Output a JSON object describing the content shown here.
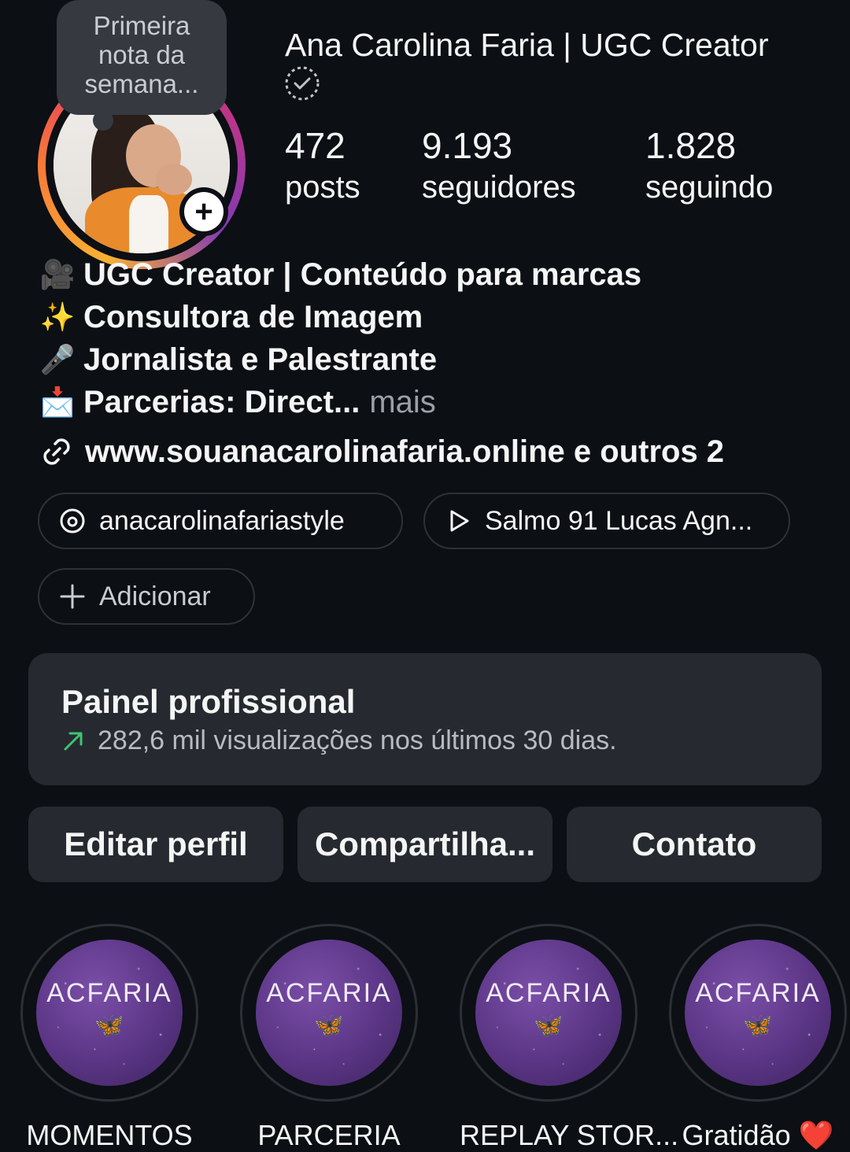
{
  "note": {
    "line1": "Primeira",
    "line2": "nota da",
    "line3": "semana..."
  },
  "profile": {
    "name": "Ana Carolina Faria | UGC Creator"
  },
  "stats": [
    {
      "value": "472",
      "label": "posts"
    },
    {
      "value": "9.193",
      "label": "seguidores"
    },
    {
      "value": "1.828",
      "label": "seguindo"
    }
  ],
  "bio": {
    "line1_emoji": "🎥",
    "line1": "UGC Creator | Conteúdo para marcas",
    "line2_emoji": "✨",
    "line2": "Consultora de Imagem",
    "line3_emoji": "🎤",
    "line3": "Jornalista e Palestrante",
    "line4_emoji": "📩",
    "line4": "Parcerias: Direct...",
    "more": "mais"
  },
  "link": {
    "text": "www.souanacarolinafaria.online e outros 2"
  },
  "pills": {
    "threads": "anacarolinafariastyle",
    "music": "Salmo 91 Lucas Agn...",
    "add": "Adicionar"
  },
  "dashboard": {
    "title": "Painel profissional",
    "subtitle": "282,6 mil visualizações nos últimos 30 dias.",
    "trend_color": "#3ec46d"
  },
  "actions": {
    "edit": "Editar perfil",
    "share": "Compartilha...",
    "contact": "Contato"
  },
  "highlights": [
    {
      "brand": "ACFARIA",
      "label": "MOMENTOS"
    },
    {
      "brand": "ACFARIA",
      "label": "PARCERIA"
    },
    {
      "brand": "ACFARIA",
      "label": "REPLAY STOR..."
    },
    {
      "brand": "ACFARIA",
      "label": "Gratidão ❤️"
    }
  ]
}
